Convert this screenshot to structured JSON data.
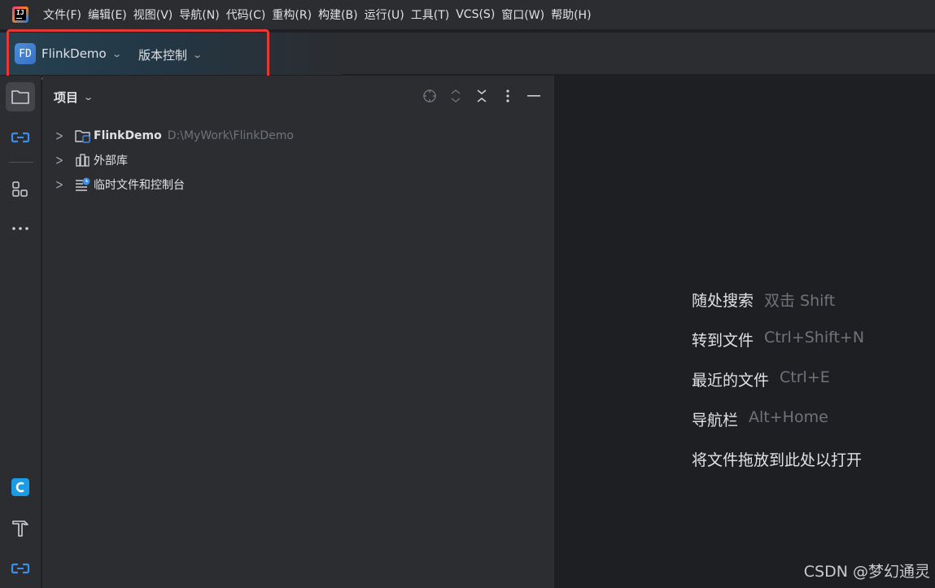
{
  "app": {
    "logo_text": "IJ"
  },
  "menu": [
    "文件(F)",
    "编辑(E)",
    "视图(V)",
    "导航(N)",
    "代码(C)",
    "重构(R)",
    "构建(B)",
    "运行(U)",
    "工具(T)",
    "VCS(S)",
    "窗口(W)",
    "帮助(H)"
  ],
  "toolbar": {
    "project_badge": "FD",
    "project_name": "FlinkDemo",
    "vcs_label": "版本控制"
  },
  "left_strip": {
    "top_icons": [
      "folder-icon",
      "commit-icon",
      "structure-icon",
      "more-icon"
    ],
    "bottom_icons": [
      "ai-assistant-icon",
      "build-hammer-icon",
      "commit-icon"
    ]
  },
  "project_panel": {
    "title": "项目",
    "actions": [
      "locate-icon",
      "expand-all-icon",
      "collapse-all-icon",
      "options-icon",
      "hide-icon"
    ],
    "tree": [
      {
        "label": "FlinkDemo",
        "path": "D:\\MyWork\\FlinkDemo",
        "icon": "module-folder-icon"
      },
      {
        "label": "外部库",
        "path": "",
        "icon": "library-icon"
      },
      {
        "label": "临时文件和控制台",
        "path": "",
        "icon": "scratches-icon"
      }
    ]
  },
  "editor": {
    "tips": [
      {
        "label": "随处搜索",
        "key": "双击 Shift"
      },
      {
        "label": "转到文件",
        "key": "Ctrl+Shift+N"
      },
      {
        "label": "最近的文件",
        "key": "Ctrl+E"
      },
      {
        "label": "导航栏",
        "key": "Alt+Home"
      },
      {
        "label": "将文件拖放到此处以打开",
        "key": ""
      }
    ]
  },
  "watermark": "CSDN @梦幻通灵",
  "colors": {
    "highlight": "#e53935",
    "accent": "#3574f0",
    "bg": "#1e1f22",
    "panel": "#2b2d30"
  }
}
